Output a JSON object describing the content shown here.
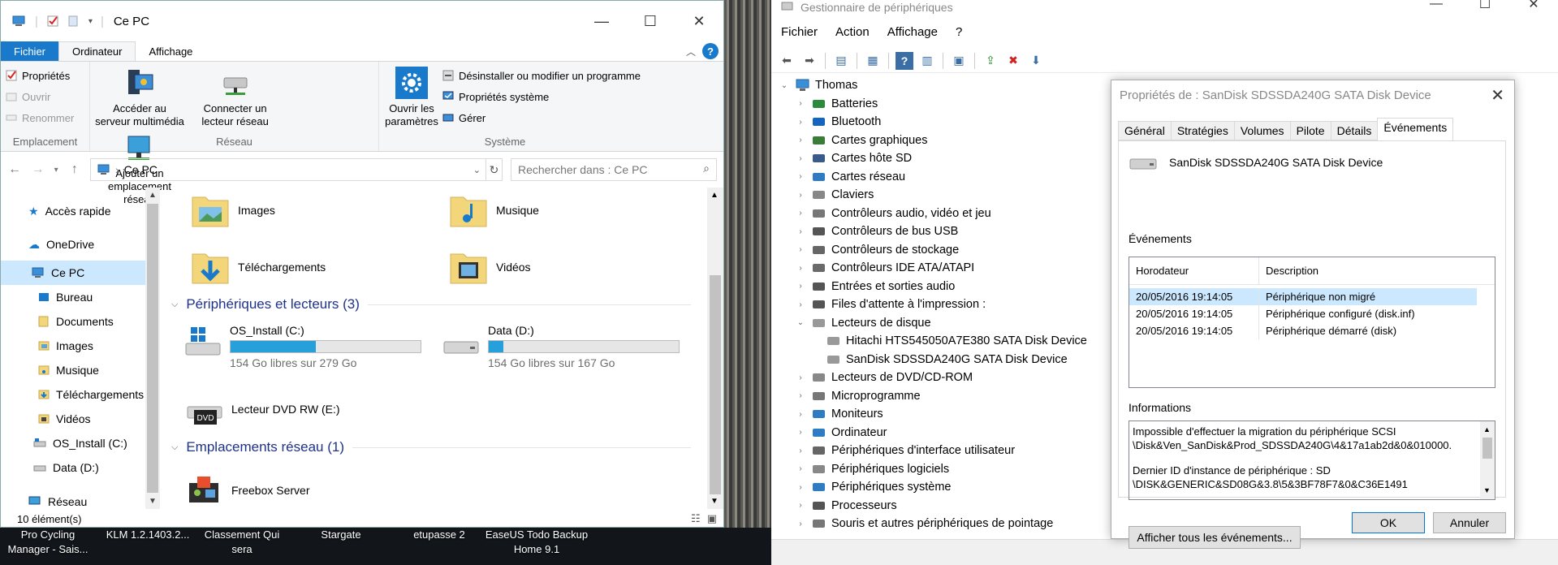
{
  "desktop": {
    "labels": [
      {
        "text": "Pro Cycling Manager - Sais..."
      },
      {
        "text": "KLM 1.2.1403.2..."
      },
      {
        "text": "Classement Qui sera"
      },
      {
        "text": "Stargate"
      },
      {
        "text": "etupasse 2"
      },
      {
        "text": "EaseUS Todo Backup Home 9.1"
      }
    ]
  },
  "explorer": {
    "title": "Ce PC",
    "tabs": {
      "file": "Fichier",
      "computer": "Ordinateur",
      "view": "Affichage"
    },
    "ribbon": {
      "location": {
        "properties": "Propriétés",
        "open": "Ouvrir",
        "rename": "Renommer",
        "group": "Emplacement"
      },
      "network": {
        "media_server": "Accéder au serveur multimédia",
        "map_drive": "Connecter un lecteur réseau",
        "add_location": "Ajouter un emplacement réseau",
        "group": "Réseau"
      },
      "system": {
        "open_settings": "Ouvrir les paramètres",
        "uninstall": "Désinstaller ou modifier un programme",
        "sys_props": "Propriétés système",
        "manage": "Gérer",
        "group": "Système"
      }
    },
    "address": {
      "path": "Ce PC",
      "search_placeholder": "Rechercher dans : Ce PC"
    },
    "nav": {
      "quick": "Accès rapide",
      "onedrive": "OneDrive",
      "thispc": "Ce PC",
      "desktop": "Bureau",
      "documents": "Documents",
      "images": "Images",
      "music": "Musique",
      "downloads": "Téléchargements",
      "videos": "Vidéos",
      "osinstall": "OS_Install (C:)",
      "data": "Data (D:)",
      "network": "Réseau"
    },
    "folders": {
      "images": "Images",
      "music": "Musique",
      "downloads": "Téléchargements",
      "videos": "Vidéos"
    },
    "sections": {
      "devices": "Périphériques et lecteurs (3)",
      "netloc": "Emplacements réseau (1)"
    },
    "drives": {
      "c": {
        "name": "OS_Install (C:)",
        "free": "154 Go libres sur 279 Go",
        "used_fraction": 0.448
      },
      "d": {
        "name": "Data (D:)",
        "free": "154 Go libres sur 167 Go",
        "used_fraction": 0.078
      },
      "dvd": {
        "name": "Lecteur DVD RW (E:)",
        "badge": "DVD"
      }
    },
    "netloc": {
      "freebox": "Freebox Server"
    },
    "status": "10 élément(s)"
  },
  "devmgr": {
    "title": "Gestionnaire de périphériques",
    "menu": {
      "file": "Fichier",
      "action": "Action",
      "view": "Affichage",
      "help": "?"
    },
    "tree": {
      "root": "Thomas",
      "batteries": "Batteries",
      "bluetooth": "Bluetooth",
      "graphics": "Cartes graphiques",
      "sdhost": "Cartes hôte SD",
      "netcards": "Cartes réseau",
      "keyboards": "Claviers",
      "audio": "Contrôleurs audio, vidéo et jeu",
      "usb": "Contrôleurs de bus USB",
      "storage": "Contrôleurs de stockage",
      "ide": "Contrôleurs IDE ATA/ATAPI",
      "audio_io": "Entrées et sorties audio",
      "printq": "Files d'attente à l'impression :",
      "disks": "Lecteurs de disque",
      "disk1": "Hitachi HTS545050A7E380 SATA Disk Device",
      "disk2": "SanDisk SDSSDA240G SATA Disk Device",
      "dvd": "Lecteurs de DVD/CD-ROM",
      "firmware": "Microprogramme",
      "monitors": "Moniteurs",
      "computer": "Ordinateur",
      "hid": "Périphériques d'interface utilisateur",
      "software": "Périphériques logiciels",
      "system": "Périphériques système",
      "cpu": "Processeurs",
      "mice": "Souris et autres périphériques de pointage"
    }
  },
  "dialog": {
    "title": "Propriétés de : SanDisk SDSSDA240G SATA Disk Device",
    "tabs": {
      "general": "Général",
      "policies": "Stratégies",
      "volumes": "Volumes",
      "driver": "Pilote",
      "details": "Détails",
      "events": "Événements"
    },
    "device_name": "SanDisk SDSSDA240G SATA Disk Device",
    "events_label": "Événements",
    "col_time": "Horodateur",
    "col_desc": "Description",
    "events": [
      {
        "time": "20/05/2016 19:14:05",
        "desc": "Périphérique non migré"
      },
      {
        "time": "20/05/2016 19:14:05",
        "desc": "Périphérique configuré (disk.inf)"
      },
      {
        "time": "20/05/2016 19:14:05",
        "desc": "Périphérique démarré (disk)"
      }
    ],
    "info_label": "Informations",
    "info_line1": "Impossible d'effectuer la migration du périphérique SCSI",
    "info_line2": "\\Disk&Ven_SanDisk&Prod_SDSSDA240G\\4&17a1ab2d&0&010000.",
    "info_line3": "Dernier ID d'instance de périphérique : SD",
    "info_line4": "\\DISK&GENERIC&SD08G&3.8\\5&3BF78F7&0&C36E1491",
    "show_all": "Afficher tous les événements...",
    "ok": "OK",
    "cancel": "Annuler"
  }
}
